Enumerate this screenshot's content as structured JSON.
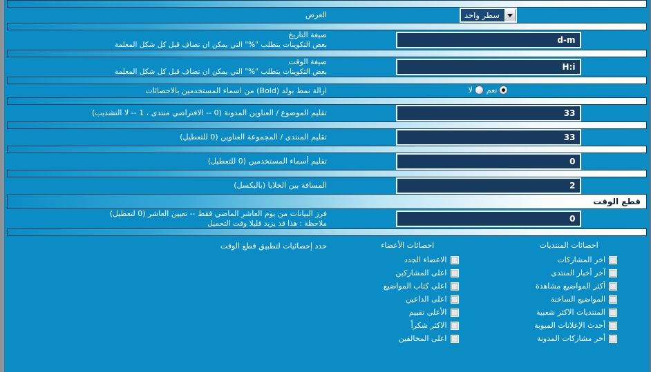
{
  "theme": {
    "background": "#0b8cc4",
    "input_bg": "#173a5e",
    "input_border": "#eaf4fb",
    "text": "#ffffff",
    "header_text": "#0a2436"
  },
  "rows": [
    {
      "name": "display",
      "label": "العرض",
      "sub": "",
      "control": "select",
      "value": "سطر واحد"
    },
    {
      "name": "date-format",
      "label": "صيغة التاريخ",
      "sub": "بعض التكوينات يتطلب \"%\" التي يمكن ان تضاف قبل كل شكل المعلمة",
      "control": "text",
      "value": "d-m"
    },
    {
      "name": "time-format",
      "label": "صيغة الوقت",
      "sub": "بعض التكوينات يتطلب \"%\" التي يمكن ان تضاف قبل كل شكل المعلمة",
      "control": "text",
      "value": "H:i"
    },
    {
      "name": "remove-bold",
      "label": "ازالة نمط بولد (Bold) من اسماء المستخدمين بالاحصائات",
      "sub": "",
      "control": "radio",
      "options": [
        "نعم",
        "لا"
      ],
      "selected": 0
    },
    {
      "name": "trim-thread-blog-titles",
      "label": "تقليم الموضوع / العناوين المدونة (0 -- الافتراضي منتدى ، 1 -- لا التشذيب)",
      "sub": "",
      "control": "text",
      "value": "33"
    },
    {
      "name": "trim-forum-group-titles",
      "label": "تقليم المنتدى / المجموعة العناوين (0 للتعطيل)",
      "sub": "",
      "control": "text",
      "value": "33"
    },
    {
      "name": "trim-usernames",
      "label": "تقليم أسماء المستخدمين (0 للتعطيل)",
      "sub": "",
      "control": "text",
      "value": "0"
    },
    {
      "name": "cell-spacing",
      "label": "المسافة بين الخلايا (بالبكسل)",
      "sub": "",
      "control": "text",
      "value": "2"
    }
  ],
  "section": {
    "name": "time-cut",
    "title": "قطع الوقت"
  },
  "cutoff_row": {
    "name": "sort-data-last-x-days",
    "label": "فرز البيانات من يوم العاشر الماضي فقط -- تعيين العاشر (0 لتعطيل)",
    "sub": "ملاحظة : هذا قد يزيد قليلا وقت التحميل",
    "value": "0"
  },
  "checkbox_section": {
    "label": "حدد إحصائيات لتطبيق قطع الوقت",
    "columns": [
      {
        "name": "forum-stats",
        "title": "احصائات المنتديات",
        "items": [
          {
            "label": "اخر المشاركات",
            "checked": false
          },
          {
            "label": "آخر أخبار المنتدى",
            "checked": false
          },
          {
            "label": "أكثر المواضيع مشاهدة",
            "checked": false
          },
          {
            "label": "المواضيع الساخنة",
            "checked": false
          },
          {
            "label": "المنتديات الاكثر شعبية",
            "checked": false
          },
          {
            "label": "أحدث الإعلانات المبوبة",
            "checked": false
          },
          {
            "label": "أخر مشاركات المدونة",
            "checked": false
          }
        ]
      },
      {
        "name": "member-stats",
        "title": "احصائات الأعضاء",
        "items": [
          {
            "label": "الاعضاء الجدد",
            "checked": false
          },
          {
            "label": "اعلى المشاركين",
            "checked": false
          },
          {
            "label": "اعلى كتاب المواضيع",
            "checked": false
          },
          {
            "label": "اعلى الداعين",
            "checked": false
          },
          {
            "label": "الأعلى تقييم",
            "checked": false
          },
          {
            "label": "الاكثر شكراً",
            "checked": false
          },
          {
            "label": "اعلى المخالفين",
            "checked": false
          }
        ]
      }
    ]
  }
}
